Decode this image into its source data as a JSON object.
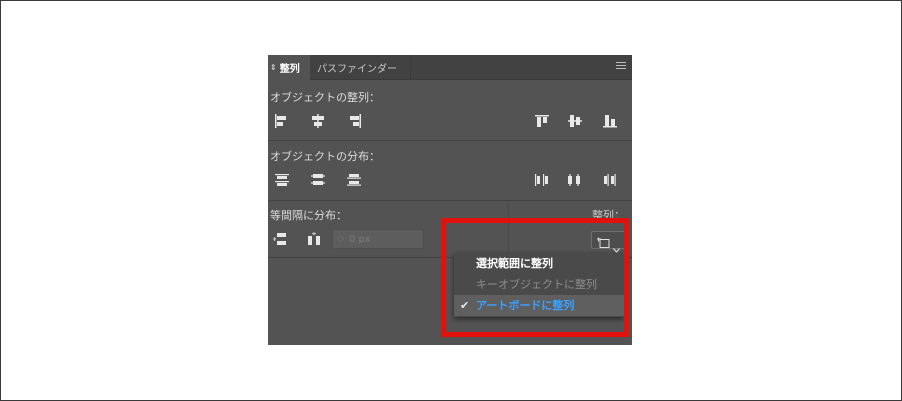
{
  "tabs": {
    "active_label": "整列",
    "inactive_label": "パスファインダー"
  },
  "sections": {
    "align_objects": "オブジェクトの整列：",
    "distribute_objects": "オブジェクトの分布：",
    "distribute_spacing": "等間隔に分布：",
    "align_to": "整列："
  },
  "spacing_input": {
    "value": "0 px"
  },
  "dropdown": {
    "items": [
      {
        "label": "選択範囲に整列",
        "state": "enabled"
      },
      {
        "label": "キーオブジェクトに整列",
        "state": "disabled"
      },
      {
        "label": "アートボードに整列",
        "state": "selected"
      }
    ],
    "check_glyph": "✔"
  },
  "colors": {
    "panel_bg": "#535353",
    "highlight": "#e3100b",
    "selected_text": "#3aa0ff"
  },
  "icons": [
    "sort-icon",
    "panel-menu-icon",
    "align-left-icon",
    "align-horizontal-center-icon",
    "align-right-icon",
    "align-top-icon",
    "align-vertical-center-icon",
    "align-bottom-icon",
    "distribute-top-icon",
    "distribute-vertical-center-icon",
    "distribute-bottom-icon",
    "distribute-left-icon",
    "distribute-horizontal-center-icon",
    "distribute-right-icon",
    "vertical-distribute-space-icon",
    "horizontal-distribute-space-icon",
    "artboard-icon",
    "chevron-down-icon",
    "checkmark-icon"
  ]
}
